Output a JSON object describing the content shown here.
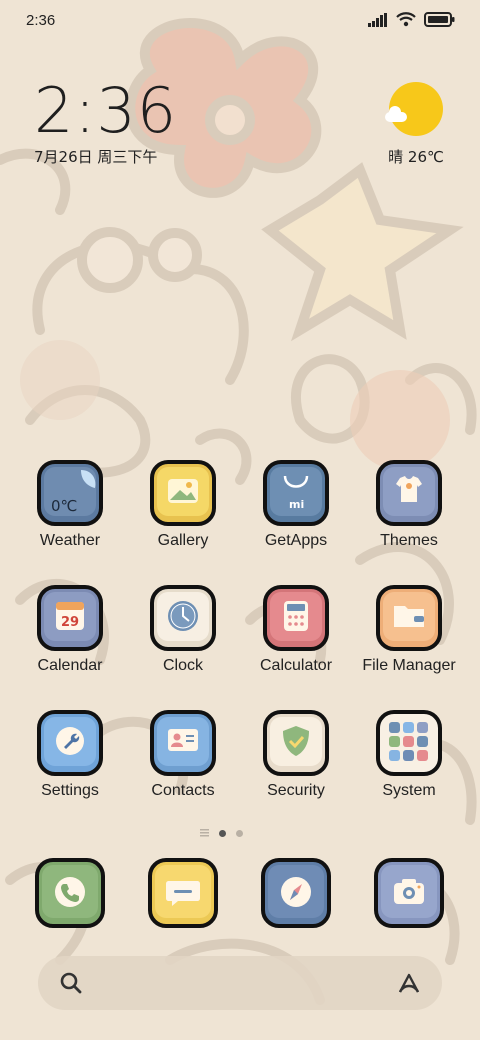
{
  "status_bar": {
    "time": "2:36",
    "icons": [
      "signal-icon",
      "wifi-icon",
      "battery-icon"
    ]
  },
  "clock_widget": {
    "time": "2:36",
    "date": "7月26日 周三下午"
  },
  "weather_widget": {
    "text": "晴 26℃",
    "icon": "sun-cloud-icon"
  },
  "apps": [
    {
      "label": "Weather",
      "icon": "weather-icon",
      "color": "#6f8cb0",
      "glyph": "0℃"
    },
    {
      "label": "Gallery",
      "icon": "gallery-icon",
      "color": "#f5d867"
    },
    {
      "label": "GetApps",
      "icon": "getapps-icon",
      "color": "#6e8fb3",
      "glyph": "mi"
    },
    {
      "label": "Themes",
      "icon": "themes-icon",
      "color": "#8e9ec4"
    },
    {
      "label": "Calendar",
      "icon": "calendar-icon",
      "color": "#8d9cc2",
      "glyph": "29"
    },
    {
      "label": "Clock",
      "icon": "clock-icon",
      "color": "#f7efe3"
    },
    {
      "label": "Calculator",
      "icon": "calculator-icon",
      "color": "#e58a8e"
    },
    {
      "label": "File Manager",
      "icon": "folder-icon",
      "color": "#f6c08f"
    },
    {
      "label": "Settings",
      "icon": "settings-icon",
      "color": "#86b6e6"
    },
    {
      "label": "Contacts",
      "icon": "contacts-icon",
      "color": "#86b4e2"
    },
    {
      "label": "Security",
      "icon": "security-icon",
      "color": "#f8efe1"
    },
    {
      "label": "System",
      "icon": "system-folder-icon",
      "color": "#f8f0e4"
    }
  ],
  "page_indicator": {
    "pages": 2,
    "active": 0
  },
  "dock": [
    {
      "name": "phone",
      "icon": "phone-icon",
      "color": "#8fb77d"
    },
    {
      "name": "messages",
      "icon": "message-icon",
      "color": "#f7d86f"
    },
    {
      "name": "browser",
      "icon": "compass-icon",
      "color": "#6f8cb5"
    },
    {
      "name": "camera",
      "icon": "camera-icon",
      "color": "#97a6cc"
    }
  ],
  "search_bar": {
    "search_icon": "search-icon",
    "assistant_icon": "assistant-icon"
  }
}
